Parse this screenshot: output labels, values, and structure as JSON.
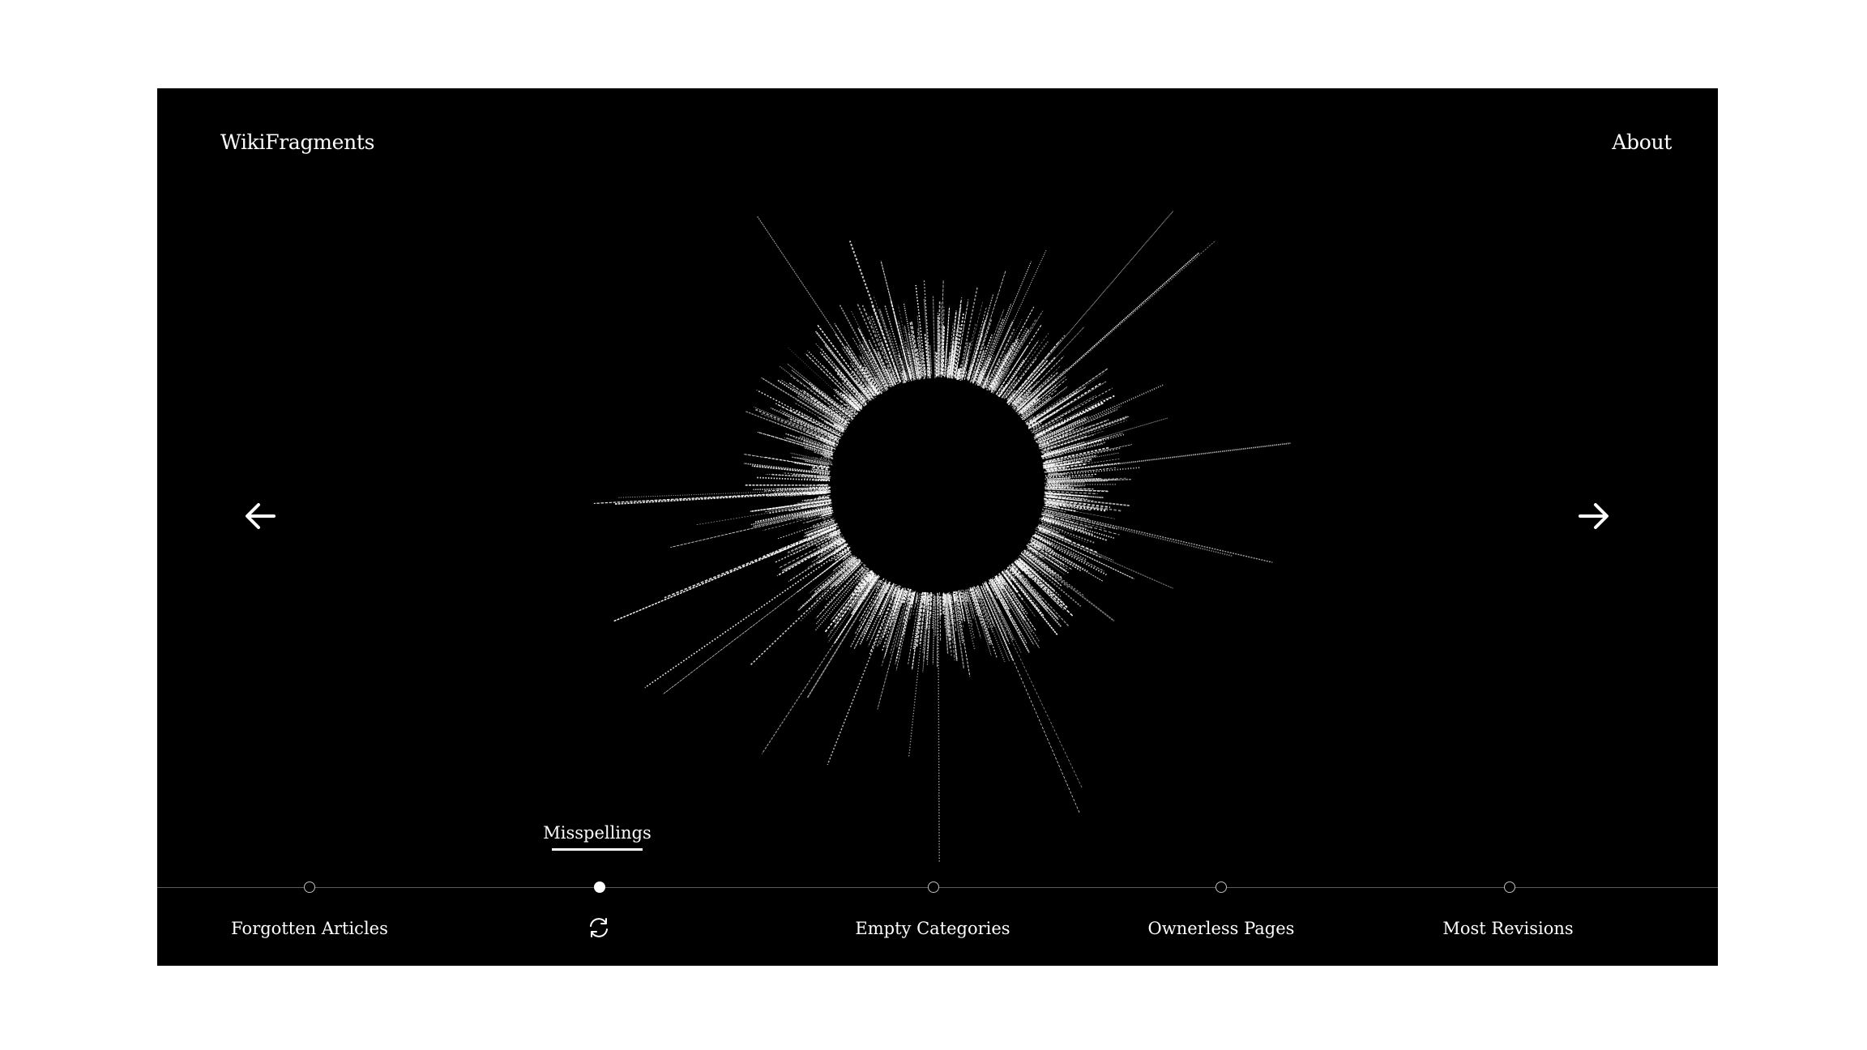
{
  "header": {
    "brand": "WikiFragments",
    "about_link": "About"
  },
  "navigation": {
    "prev_icon": "arrow-left-icon",
    "next_icon": "arrow-right-icon"
  },
  "timeline": {
    "items": [
      {
        "label": "Forgotten Articles",
        "active": false
      },
      {
        "label": "Misspellings",
        "active": true,
        "action_icon": "refresh-icon"
      },
      {
        "label": "Empty Categories",
        "active": false
      },
      {
        "label": "Ownerless Pages",
        "active": false
      },
      {
        "label": "Most Revisions",
        "active": false
      }
    ]
  },
  "colors": {
    "background": "#000000",
    "foreground": "#ffffff",
    "frame": "#ffffff"
  }
}
